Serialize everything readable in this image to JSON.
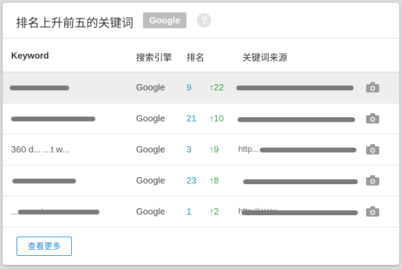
{
  "header": {
    "title": "排名上升前五的关键词",
    "engine_badge": "Google",
    "help_symbol": "?"
  },
  "table": {
    "columns": {
      "keyword": "Keyword",
      "engine": "搜索引擎",
      "rank": "排名",
      "source": "关键词来源"
    },
    "rows": [
      {
        "keyword": "",
        "engine": "Google",
        "rank": "9",
        "change": "↑22",
        "source": ""
      },
      {
        "keyword": "",
        "engine": "Google",
        "rank": "21",
        "change": "↑10",
        "source": ""
      },
      {
        "keyword": "360 d... ...t w...",
        "engine": "Google",
        "rank": "3",
        "change": "↑9",
        "source": "http..."
      },
      {
        "keyword": "",
        "engine": "Google",
        "rank": "23",
        "change": "↑8",
        "source": ""
      },
      {
        "keyword": "...mount",
        "engine": "Google",
        "rank": "1",
        "change": "↑2",
        "source": "http://www..."
      }
    ]
  },
  "footer": {
    "more_label": "查看更多"
  },
  "colors": {
    "rank": "#2a8fd0",
    "change": "#3aa648",
    "accent": "#2a8fd0"
  },
  "icons": {
    "row_action": "camera-icon",
    "help": "help-icon"
  }
}
